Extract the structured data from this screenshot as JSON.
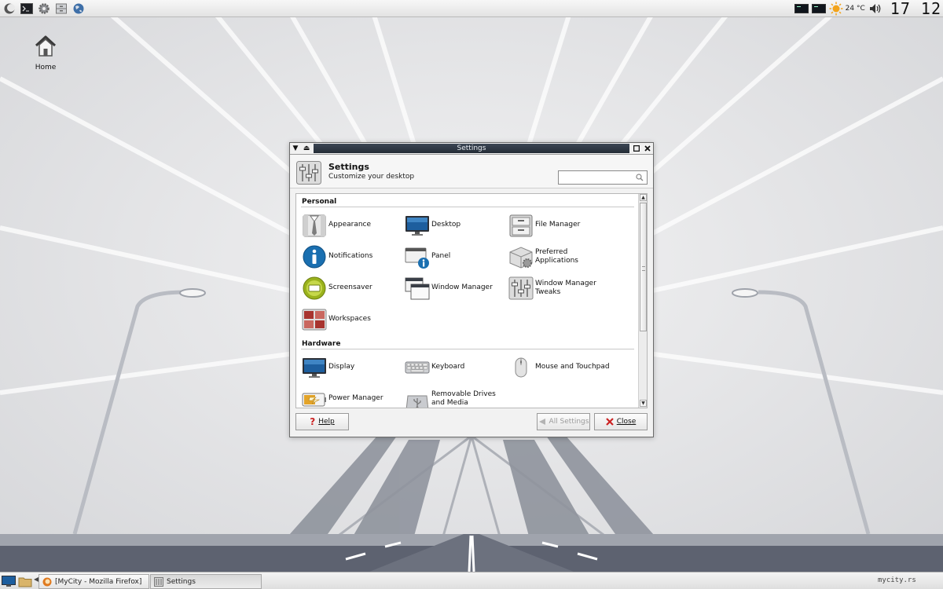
{
  "top_panel": {
    "launchers": [
      "app-menu-icon",
      "terminal-icon",
      "gear-icon",
      "drawer-icon",
      "globe-icon"
    ],
    "weather_text": "24 °C",
    "clock": "17 12"
  },
  "desktop": {
    "icons": [
      {
        "label": "Home",
        "icon": "home-icon"
      }
    ]
  },
  "window": {
    "title": "Settings",
    "header_title": "Settings",
    "header_subtitle": "Customize your desktop",
    "search": {
      "value": "",
      "placeholder": ""
    },
    "sections": [
      {
        "title": "Personal",
        "items": [
          {
            "label": "Appearance",
            "icon": "appearance-icon"
          },
          {
            "label": "Desktop",
            "icon": "desktop-monitor-icon"
          },
          {
            "label": "File Manager",
            "icon": "file-cabinet-icon"
          },
          {
            "label": "Notifications",
            "icon": "info-icon"
          },
          {
            "label": "Panel",
            "icon": "panel-icon"
          },
          {
            "label": "Preferred Applications",
            "icon": "preferred-apps-icon"
          },
          {
            "label": "Screensaver",
            "icon": "screensaver-icon"
          },
          {
            "label": "Window Manager",
            "icon": "window-manager-icon"
          },
          {
            "label": "Window Manager Tweaks",
            "icon": "tweaks-icon"
          },
          {
            "label": "Workspaces",
            "icon": "workspaces-icon"
          }
        ]
      },
      {
        "title": "Hardware",
        "items": [
          {
            "label": "Display",
            "icon": "display-icon"
          },
          {
            "label": "Keyboard",
            "icon": "keyboard-icon"
          },
          {
            "label": "Mouse and Touchpad",
            "icon": "mouse-icon"
          },
          {
            "label": "Power Manager",
            "icon": "battery-icon"
          },
          {
            "label": "Removable Drives and Media",
            "icon": "usb-icon"
          }
        ]
      }
    ],
    "buttons": {
      "help": "Help",
      "all_settings": "All Settings",
      "close": "Close"
    }
  },
  "taskbar": {
    "tasks": [
      {
        "label": "[MyCity - Mozilla Firefox]",
        "icon": "firefox-icon",
        "active": false
      },
      {
        "label": "Settings",
        "icon": "settings-icon",
        "active": true
      }
    ],
    "tray_text": "mycity.rs"
  },
  "colors": {
    "title_strip": "#2e3642",
    "accent_blue": "#1a6fb0",
    "close_red": "#cc2222",
    "help_red": "#cc2222"
  }
}
